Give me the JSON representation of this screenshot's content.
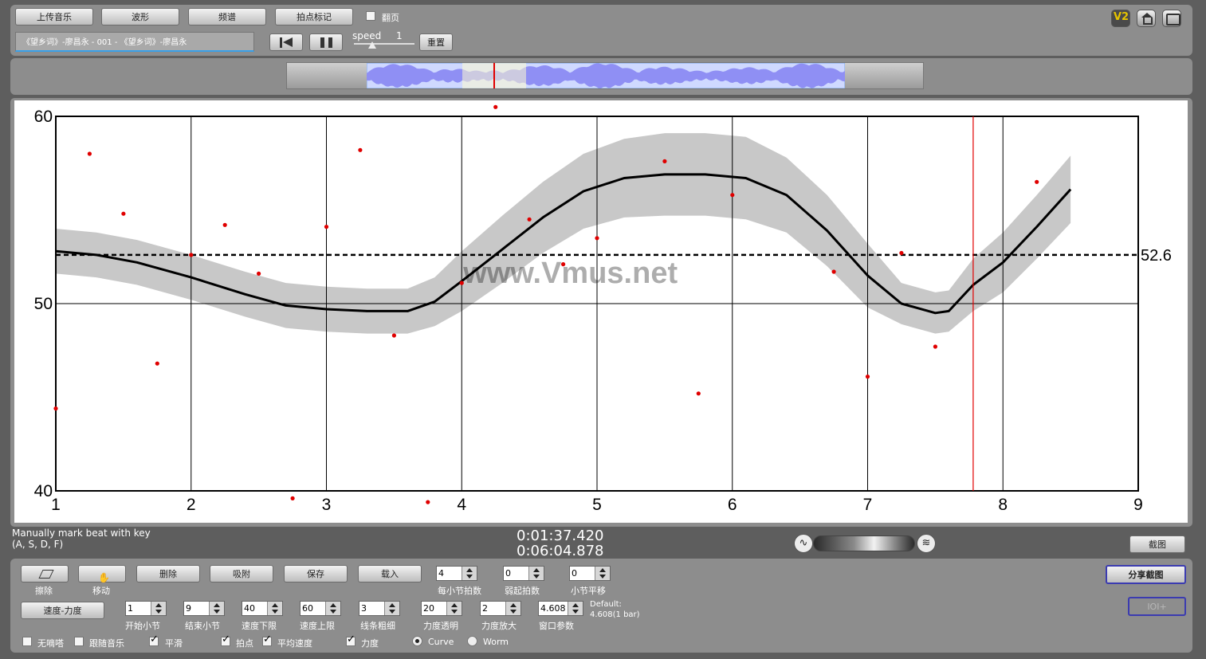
{
  "toolbar": {
    "upload": "上传音乐",
    "waveform": "波形",
    "spectrum": "频谱",
    "beat_mark": "拍点标记",
    "page_flip_label": "翻页",
    "page_flip_checked": false,
    "track_title": "《望乡词》-廖昌永 - 001 - 《望乡词》-廖昌永",
    "speed_label": "speed",
    "speed_value": "1",
    "reset": "重置",
    "v2_label": "V2"
  },
  "chart_data": {
    "type": "scatter",
    "x_ticks": [
      "1",
      "2",
      "3",
      "4",
      "5",
      "6",
      "7",
      "8",
      "9"
    ],
    "y_ticks": [
      "60",
      "50",
      "40"
    ],
    "xlim": [
      1,
      9
    ],
    "ylim": [
      40,
      60
    ],
    "average_value": 52.6,
    "average_label": "52.6",
    "cursor_x": 7.78,
    "watermark": "www.Vmus.net",
    "points": [
      {
        "x": 1.0,
        "y": 44.4
      },
      {
        "x": 1.25,
        "y": 58.0
      },
      {
        "x": 1.5,
        "y": 54.8
      },
      {
        "x": 1.75,
        "y": 46.8
      },
      {
        "x": 2.0,
        "y": 52.6
      },
      {
        "x": 2.25,
        "y": 54.2
      },
      {
        "x": 2.5,
        "y": 51.6
      },
      {
        "x": 2.75,
        "y": 39.6
      },
      {
        "x": 3.0,
        "y": 54.1
      },
      {
        "x": 3.25,
        "y": 58.2
      },
      {
        "x": 3.5,
        "y": 48.3
      },
      {
        "x": 3.75,
        "y": 39.4
      },
      {
        "x": 4.0,
        "y": 51.1
      },
      {
        "x": 4.25,
        "y": 60.5
      },
      {
        "x": 4.5,
        "y": 54.5
      },
      {
        "x": 4.75,
        "y": 52.1
      },
      {
        "x": 5.0,
        "y": 53.5
      },
      {
        "x": 5.5,
        "y": 57.6
      },
      {
        "x": 5.75,
        "y": 45.2
      },
      {
        "x": 6.0,
        "y": 55.8
      },
      {
        "x": 6.75,
        "y": 51.7
      },
      {
        "x": 7.0,
        "y": 46.1
      },
      {
        "x": 7.25,
        "y": 52.7
      },
      {
        "x": 7.5,
        "y": 47.7
      },
      {
        "x": 8.25,
        "y": 56.5
      }
    ],
    "smooth_curve": [
      {
        "x": 1.0,
        "y": 52.8
      },
      {
        "x": 1.3,
        "y": 52.6
      },
      {
        "x": 1.6,
        "y": 52.2
      },
      {
        "x": 2.0,
        "y": 51.4
      },
      {
        "x": 2.4,
        "y": 50.5
      },
      {
        "x": 2.7,
        "y": 49.9
      },
      {
        "x": 3.0,
        "y": 49.7
      },
      {
        "x": 3.3,
        "y": 49.6
      },
      {
        "x": 3.6,
        "y": 49.6
      },
      {
        "x": 3.8,
        "y": 50.1
      },
      {
        "x": 4.0,
        "y": 51.2
      },
      {
        "x": 4.3,
        "y": 52.9
      },
      {
        "x": 4.6,
        "y": 54.6
      },
      {
        "x": 4.9,
        "y": 56.0
      },
      {
        "x": 5.2,
        "y": 56.7
      },
      {
        "x": 5.5,
        "y": 56.9
      },
      {
        "x": 5.8,
        "y": 56.9
      },
      {
        "x": 6.1,
        "y": 56.7
      },
      {
        "x": 6.4,
        "y": 55.8
      },
      {
        "x": 6.7,
        "y": 53.9
      },
      {
        "x": 7.0,
        "y": 51.5
      },
      {
        "x": 7.25,
        "y": 50.0
      },
      {
        "x": 7.5,
        "y": 49.5
      },
      {
        "x": 7.6,
        "y": 49.6
      },
      {
        "x": 7.78,
        "y": 51.0
      },
      {
        "x": 8.0,
        "y": 52.2
      },
      {
        "x": 8.25,
        "y": 54.1
      },
      {
        "x": 8.5,
        "y": 56.1
      }
    ],
    "band_halfwidth": [
      1.2,
      1.2,
      1.2,
      1.2,
      1.2,
      1.2,
      1.2,
      1.2,
      1.2,
      1.3,
      1.6,
      1.8,
      1.9,
      2.0,
      2.1,
      2.2,
      2.2,
      2.2,
      2.0,
      1.9,
      1.7,
      1.1,
      1.1,
      1.1,
      1.4,
      1.6,
      1.7,
      1.8
    ]
  },
  "status": {
    "hint": "Manually mark beat with key",
    "keys": "(A, S, D, F)",
    "current_time": "0:01:37.420",
    "total_time": "0:06:04.878",
    "screenshot": "截图"
  },
  "controls": {
    "erase": "擦除",
    "move": "移动",
    "delete": "删除",
    "snap": "吸附",
    "save": "保存",
    "load": "载入",
    "beats_per_bar_value": "4",
    "beats_per_bar_label": "每小节拍数",
    "pickup_value": "0",
    "pickup_label": "弱起拍数",
    "bar_shift_value": "0",
    "bar_shift_label": "小节平移",
    "share_screenshot": "分享截图",
    "ioi": "IOI+",
    "tempo_dynamics": "速度-力度",
    "start_bar_value": "1",
    "start_bar_label": "开始小节",
    "end_bar_value": "9",
    "end_bar_label": "结束小节",
    "tempo_min_value": "40",
    "tempo_min_label": "速度下限",
    "tempo_max_value": "60",
    "tempo_max_label": "速度上限",
    "line_width_value": "3",
    "line_width_label": "线条粗细",
    "dyn_opacity_value": "20",
    "dyn_opacity_label": "力度透明",
    "dyn_zoom_value": "2",
    "dyn_zoom_label": "力度放大",
    "window_value": "4.608",
    "window_label": "窗口参数",
    "default_label": "Default:",
    "default_value": "4.608(1 bar)",
    "opt_mute": "无嘀嗒",
    "opt_follow": "跟随音乐",
    "opt_smooth": "平滑",
    "opt_beats": "拍点",
    "opt_avg": "平均速度",
    "opt_dynamics": "力度",
    "opt_curve": "Curve",
    "opt_worm": "Worm",
    "mute_checked": false,
    "follow_checked": false,
    "smooth_checked": true,
    "beats_checked": true,
    "avg_checked": true,
    "dynamics_checked": true,
    "mode": "Curve"
  },
  "colors": {
    "accent_red": "#e00000",
    "wave_blue": "#8f8ff4",
    "band_gray": "#c8c8c8",
    "v2_yellow": "#e6c400"
  }
}
